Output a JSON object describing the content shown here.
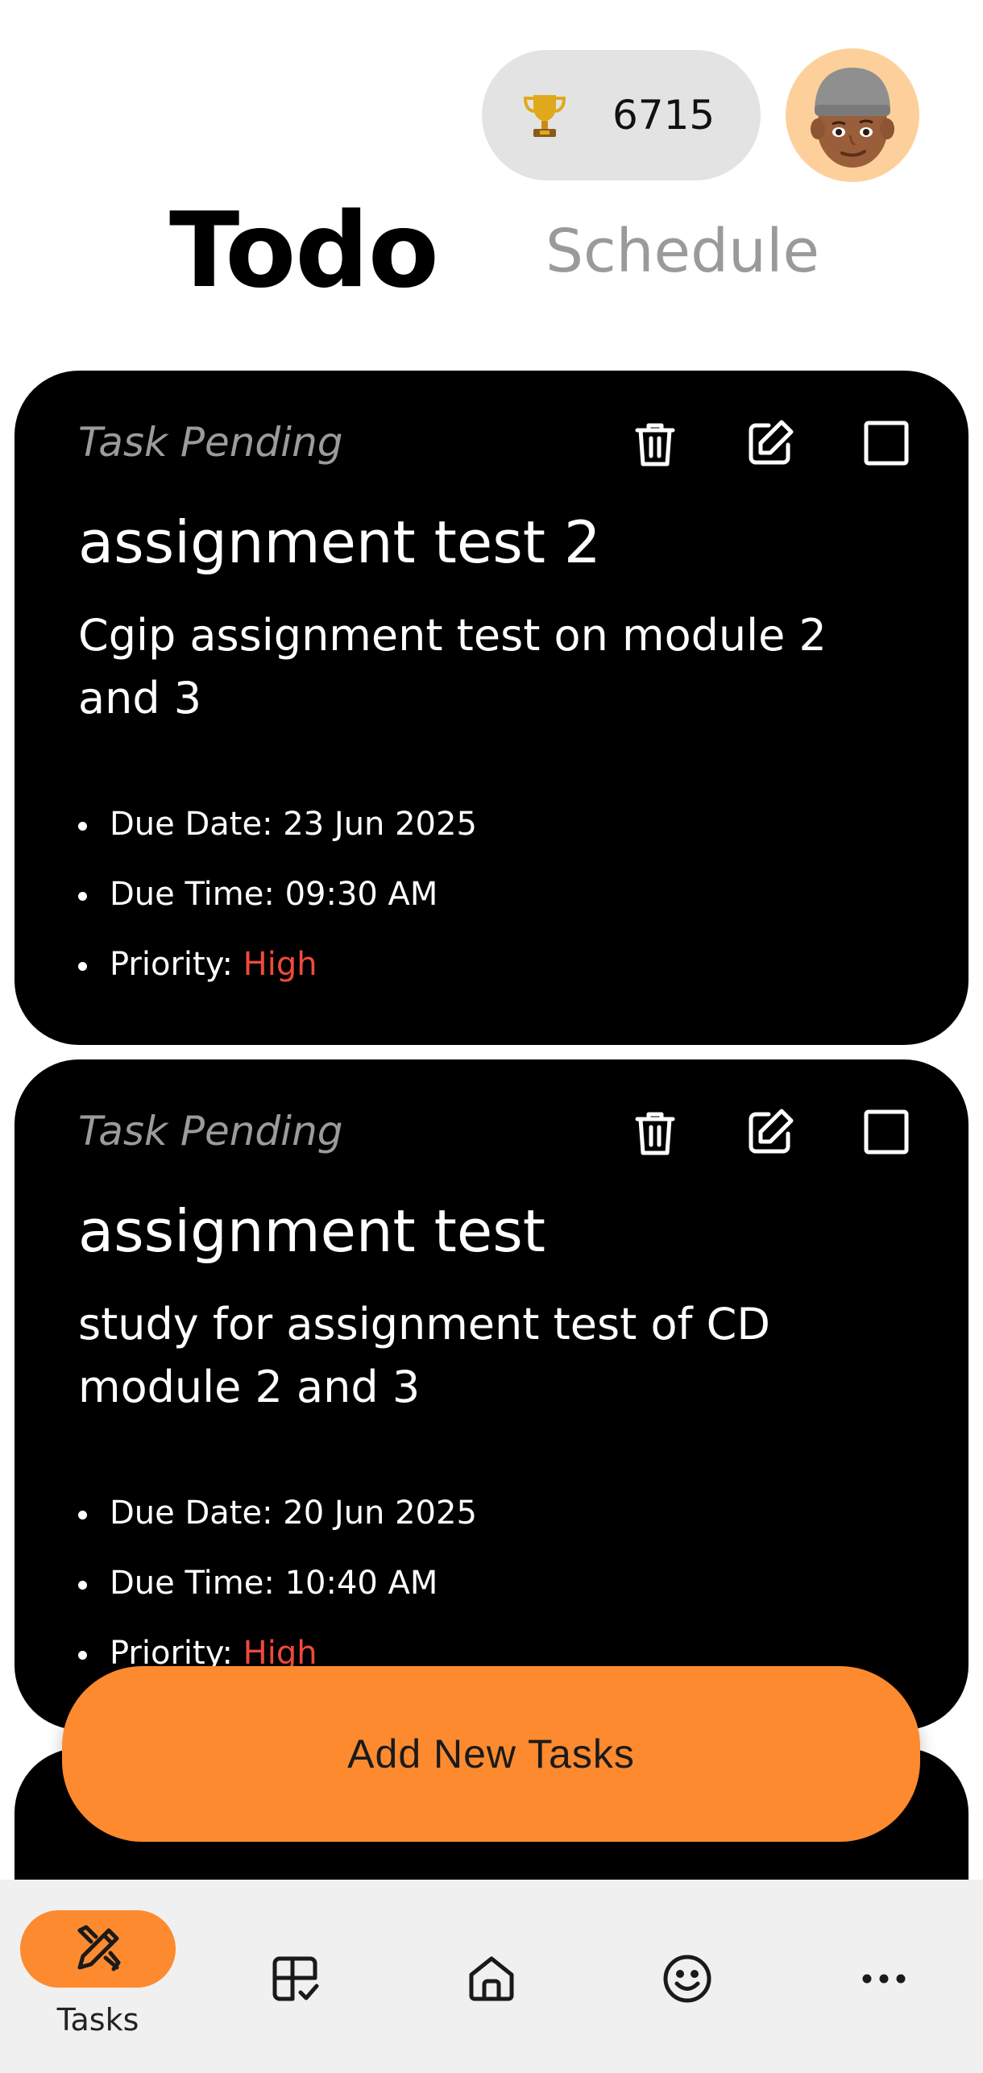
{
  "header": {
    "score": "6715",
    "trophy_icon": "trophy-icon",
    "avatar_icon": "memoji-avatar",
    "tabs": [
      {
        "label": "Todo",
        "active": true
      },
      {
        "label": "Schedule",
        "active": false
      }
    ]
  },
  "tasks": [
    {
      "status": "Task Pending",
      "title": "assignment test 2",
      "description": "Cgip assignment test on module 2 and 3",
      "due_date_label": "Due Date:",
      "due_date": "23 Jun 2025",
      "due_time_label": "Due Time:",
      "due_time": "09:30 AM",
      "priority_label": "Priority:",
      "priority": "High"
    },
    {
      "status": "Task Pending",
      "title": "assignment test",
      "description": "study for assignment test of CD module 2 and 3",
      "due_date_label": "Due Date:",
      "due_date": "20 Jun 2025",
      "due_time_label": "Due Time:",
      "due_time": "10:40 AM",
      "priority_label": "Priority:",
      "priority": "High"
    }
  ],
  "add_button": {
    "label": "Add New Tasks"
  },
  "nav": {
    "items": [
      {
        "label": "Tasks",
        "icon": "tasks-icon",
        "active": true
      },
      {
        "label": "",
        "icon": "grid-check-icon",
        "active": false
      },
      {
        "label": "",
        "icon": "home-icon",
        "active": false
      },
      {
        "label": "",
        "icon": "smiley-icon",
        "active": false
      },
      {
        "label": "",
        "icon": "more-icon",
        "active": false
      }
    ]
  },
  "colors": {
    "accent": "#fd8a2e",
    "priority_high": "#ef4a3c",
    "card_bg": "#000000",
    "pill_bg": "#e3e3e3",
    "nav_bg": "#f0f0f0"
  }
}
